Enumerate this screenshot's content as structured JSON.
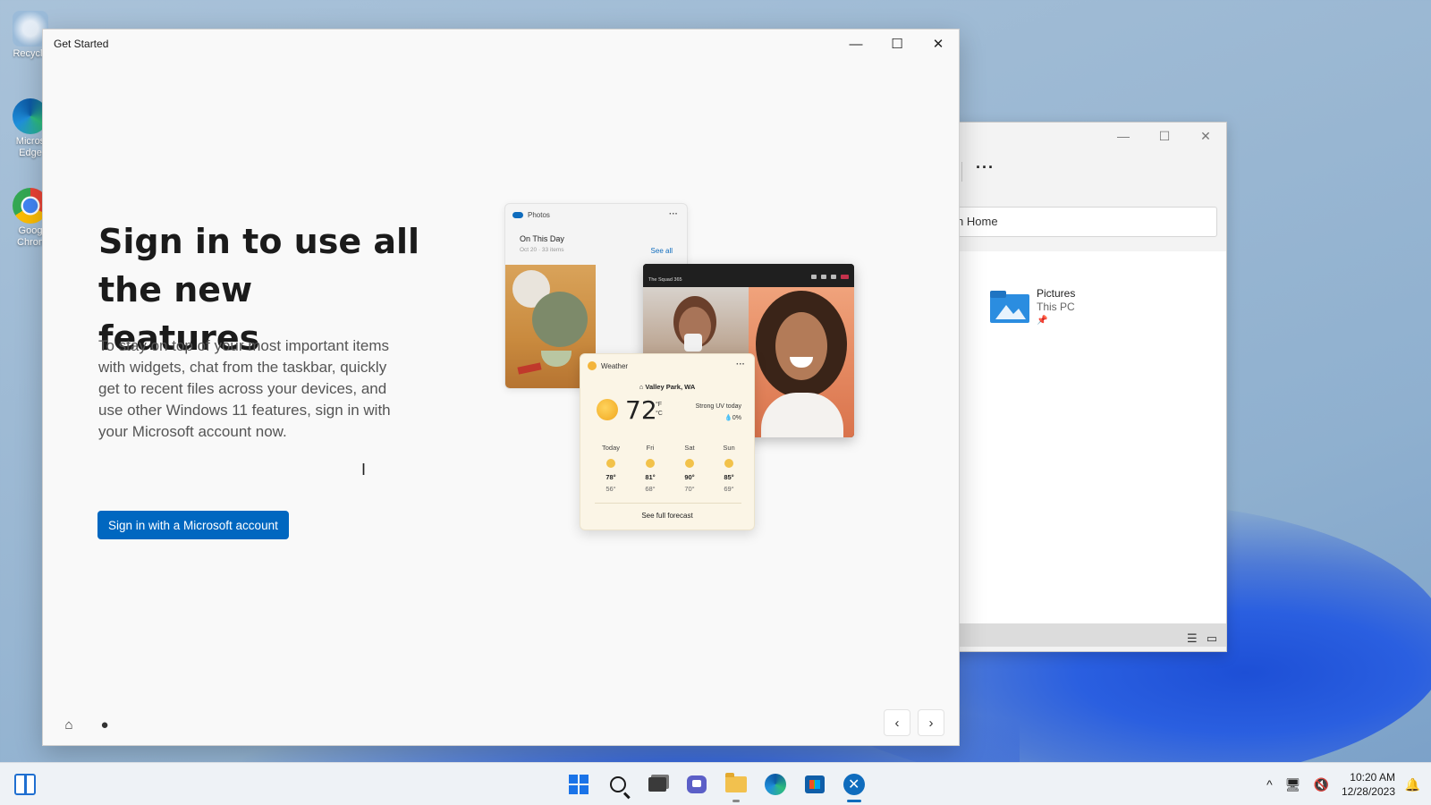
{
  "desktop": {
    "icons": [
      {
        "label_line1": "Recycle",
        "label_line2": ""
      },
      {
        "label_line1": "Micros",
        "label_line2": "Edge"
      },
      {
        "label_line1": "Goog",
        "label_line2": "Chron"
      }
    ]
  },
  "explorer": {
    "toolbar_fragment": "n",
    "more_label": "···",
    "search_text": "arch Home",
    "item_title": "Pictures",
    "item_subtitle": "This PC",
    "caption_min": "—",
    "caption_max": "☐",
    "caption_close": "✕"
  },
  "get_started": {
    "window_title": "Get Started",
    "caption_min": "—",
    "caption_max": "☐",
    "caption_close": "✕",
    "heading": "Sign in to use all the new features",
    "description": "To stay on top of your most important items with widgets, chat from the taskbar, quickly get to recent files across your devices, and use other Windows 11 features, sign in with your Microsoft account now.",
    "signin_button": "Sign in with a Microsoft account",
    "home_icon": "⌂",
    "person_icon": "●",
    "back_icon": "‹",
    "next_icon": "›"
  },
  "illustration": {
    "photos": {
      "app_name": "Photos",
      "more": "···",
      "title": "On This Day",
      "meta": "Oct 20 · 33 items",
      "see_all": "See all"
    },
    "call": {
      "title": "The Squad 365"
    },
    "weather": {
      "app_name": "Weather",
      "more": "···",
      "location": "⌂ Valley Park, WA",
      "temp": "72",
      "unit_f": "°F",
      "unit_c": "°C",
      "uv": "Strong UV today",
      "precip": "💧0%",
      "forecast": [
        {
          "day": "Today",
          "hi": "78°",
          "lo": "56°"
        },
        {
          "day": "Fri",
          "hi": "81°",
          "lo": "68°"
        },
        {
          "day": "Sat",
          "hi": "90°",
          "lo": "70°"
        },
        {
          "day": "Sun",
          "hi": "85°",
          "lo": "69°"
        }
      ],
      "see_full": "See full forecast"
    }
  },
  "taskbar": {
    "tray_chevron": "^",
    "time": "10:20 AM",
    "date": "12/28/2023",
    "bell": "🔔"
  },
  "colors": {
    "accent": "#0067c0",
    "taskbar_bg": "#eef2f6",
    "window_bg": "#f9f9f9"
  }
}
